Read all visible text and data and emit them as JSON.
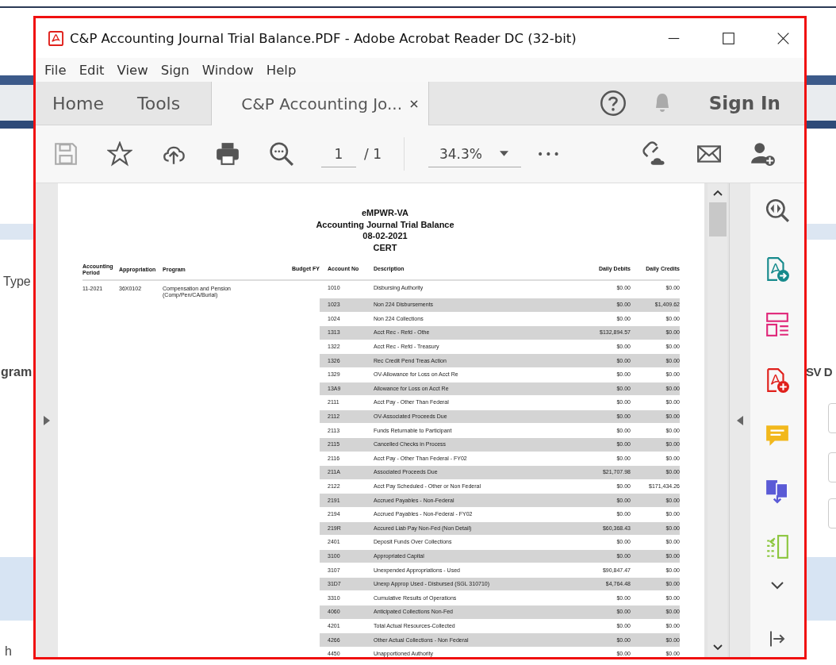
{
  "background": {
    "texts": [
      {
        "kind": "left",
        "text": "Type"
      },
      {
        "kind": "left",
        "text": "gram"
      },
      {
        "kind": "right",
        "text": "SV D"
      },
      {
        "kind": "bottom",
        "text": "h"
      }
    ]
  },
  "window": {
    "title": "C&P Accounting Journal Trial Balance.PDF - Adobe Acrobat Reader DC (32-bit)"
  },
  "menu": [
    "File",
    "Edit",
    "View",
    "Sign",
    "Window",
    "Help"
  ],
  "tabs": [
    {
      "label": "Home",
      "selected": false
    },
    {
      "label": "Tools",
      "selected": false
    },
    {
      "label": "C&P Accounting Jo...",
      "selected": true
    }
  ],
  "header": {
    "sign_in": "Sign In"
  },
  "toolbar": {
    "page": "1",
    "page_total": "/ 1",
    "zoom": "34.3%",
    "more": "•••"
  },
  "document": {
    "title_lines": [
      "eMPWR-VA",
      "Accounting Journal Trial Balance",
      "08-02-2021",
      "CERT"
    ],
    "columns": [
      "Accounting Period",
      "Appropriation",
      "Program",
      "Budget FY",
      "Account No",
      "Description",
      "Daily Debits",
      "Daily Credits"
    ],
    "group": {
      "period": "11-2021",
      "appropriation": "36X0102",
      "program": "Compensation and Pension (Comp/Pen/CA/Burial)"
    },
    "rows": [
      {
        "account": "1010",
        "description": "Disbursing Authority",
        "debits": "$0.00",
        "credits": "$0.00"
      },
      {
        "account": "1023",
        "description": "Non 224 Disbursements",
        "debits": "$0.00",
        "credits": "$1,409.62"
      },
      {
        "account": "1024",
        "description": "Non 224 Collections",
        "debits": "$0.00",
        "credits": "$0.00"
      },
      {
        "account": "1313",
        "description": "Acct Rec - Refd - Othe",
        "debits": "$132,894.57",
        "credits": "$0.00"
      },
      {
        "account": "1322",
        "description": "Acct Rec - Refd - Treasury",
        "debits": "$0.00",
        "credits": "$0.00"
      },
      {
        "account": "1326",
        "description": "Rec Credit Pend Treas Action",
        "debits": "$0.00",
        "credits": "$0.00"
      },
      {
        "account": "1329",
        "description": "OV-Allowance for Loss on Acct Re",
        "debits": "$0.00",
        "credits": "$0.00"
      },
      {
        "account": "13A9",
        "description": "Allowance for Loss on Acct Re",
        "debits": "$0.00",
        "credits": "$0.00"
      },
      {
        "account": "2111",
        "description": "Acct Pay - Other Than Federal",
        "debits": "$0.00",
        "credits": "$0.00"
      },
      {
        "account": "2112",
        "description": "OV-Associated Proceeds Due",
        "debits": "$0.00",
        "credits": "$0.00"
      },
      {
        "account": "2113",
        "description": "Funds Returnable to Participant",
        "debits": "$0.00",
        "credits": "$0.00"
      },
      {
        "account": "2115",
        "description": "Cancelled Checks in Process",
        "debits": "$0.00",
        "credits": "$0.00"
      },
      {
        "account": "2116",
        "description": "Acct Pay - Other Than Federal  - FY02",
        "debits": "$0.00",
        "credits": "$0.00"
      },
      {
        "account": "211A",
        "description": "Associated Proceeds Due",
        "debits": "$21,707.98",
        "credits": "$0.00"
      },
      {
        "account": "2122",
        "description": "Acct Pay Scheduled - Other or Non Federal",
        "debits": "$0.00",
        "credits": "$171,434.26"
      },
      {
        "account": "2191",
        "description": "Accrued Payables - Non-Federal",
        "debits": "$0.00",
        "credits": "$0.00"
      },
      {
        "account": "2194",
        "description": "Accrued Payables - Non-Federal - FY02",
        "debits": "$0.00",
        "credits": "$0.00"
      },
      {
        "account": "219R",
        "description": "Accured Liab Pay Non-Fed (Non Detail)",
        "debits": "$60,368.43",
        "credits": "$0.00"
      },
      {
        "account": "2401",
        "description": "Deposit Funds Over Collections",
        "debits": "$0.00",
        "credits": "$0.00"
      },
      {
        "account": "3100",
        "description": "Appropriated Capital",
        "debits": "$0.00",
        "credits": "$0.00"
      },
      {
        "account": "3107",
        "description": "Unexpended Appropriations - Used",
        "debits": "$90,847.47",
        "credits": "$0.00"
      },
      {
        "account": "31D7",
        "description": "Unexp Approp Used - Disbursed (SGL 310710)",
        "debits": "$4,764.48",
        "credits": "$0.00"
      },
      {
        "account": "3310",
        "description": "Cumulative Results of Operations",
        "debits": "$0.00",
        "credits": "$0.00"
      },
      {
        "account": "4060",
        "description": "Anticipated Collections Non-Fed",
        "debits": "$0.00",
        "credits": "$0.00"
      },
      {
        "account": "4201",
        "description": "Total Actual Resources-Collected",
        "debits": "$0.00",
        "credits": "$0.00"
      },
      {
        "account": "4266",
        "description": "Other Actual Collections - Non Federal",
        "debits": "$0.00",
        "credits": "$0.00"
      },
      {
        "account": "4450",
        "description": "Unapportioned Authority",
        "debits": "$0.00",
        "credits": "$0.00"
      }
    ]
  }
}
